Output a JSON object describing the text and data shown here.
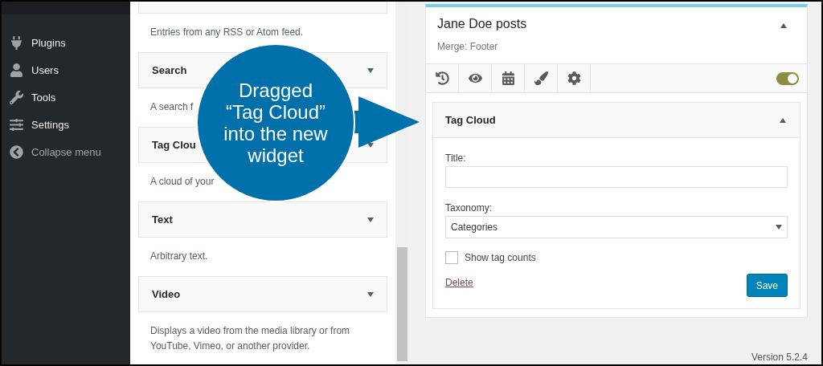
{
  "sidebar": {
    "items": [
      {
        "label": "Plugins",
        "kind": "menu"
      },
      {
        "label": "Users",
        "kind": "menu"
      },
      {
        "label": "Tools",
        "kind": "menu"
      },
      {
        "label": "Settings",
        "kind": "menu"
      },
      {
        "label": "Collapse menu",
        "kind": "collapse"
      }
    ]
  },
  "widget_list": {
    "items": [
      {
        "description": "Entries from any RSS or Atom feed."
      },
      {
        "title": "Search",
        "description": "A search f"
      },
      {
        "title": "Tag Clou",
        "description": "A cloud of your"
      },
      {
        "title": "Text",
        "description": "Arbitrary text."
      },
      {
        "title": "Video",
        "description": "Displays a video from the media library or from YouTube, Vimeo, or another provider."
      }
    ]
  },
  "callout": {
    "lines": [
      "Dragged",
      "“Tag Cloud”",
      "into the new",
      "widget"
    ]
  },
  "sidebar_widget": {
    "title": "Jane Doe posts",
    "subtitle": "Merge: Footer",
    "expanded": true,
    "toggle": {
      "on": true
    },
    "widget": {
      "title": "Tag Cloud",
      "expanded": true,
      "fields": [
        {
          "kind": "text",
          "label": "Title:"
        },
        {
          "kind": "select",
          "label": "Taxonomy:",
          "value": "Categories"
        },
        {
          "kind": "checkbox",
          "label": "Show tag counts",
          "checked": false
        }
      ],
      "delete_link": "Delete",
      "save_button": "Save"
    }
  },
  "version": "Version 5.2.4"
}
